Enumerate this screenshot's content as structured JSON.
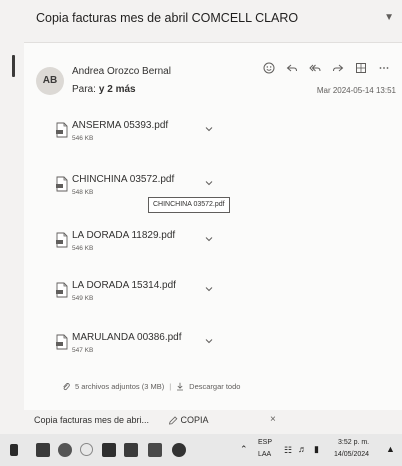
{
  "subject": "Copia facturas mes de abril COMCELL CLARO",
  "sender": {
    "initials": "AB",
    "name": "Andrea Orozco Bernal",
    "to_prefix": "Para:",
    "to_count": "y 2 más"
  },
  "date": "Mar 2024-05-14 13:51",
  "attachments": [
    {
      "name": "ANSERMA 05393.pdf",
      "size": "546 KB"
    },
    {
      "name": "CHINCHINA 03572.pdf",
      "size": "548 KB"
    },
    {
      "name": "LA DORADA 11829.pdf",
      "size": "546 KB"
    },
    {
      "name": "LA DORADA 15314.pdf",
      "size": "549 KB"
    },
    {
      "name": "MARULANDA 00386.pdf",
      "size": "547 KB"
    }
  ],
  "tooltip": "CHINCHINA 03572.pdf",
  "summary": {
    "count_text": "5 archivos adjuntos (3 MB)",
    "download_all": "Descargar todo"
  },
  "bottom_tabs": {
    "draft_tab": "Copia facturas mes de abri...",
    "copy_tab": "COPIA",
    "close": "×"
  },
  "tray": {
    "lang": "ESP",
    "layout": "LAA",
    "time": "3:52 p. m.",
    "date": "14/05/2024"
  },
  "icons": {
    "emoji": "smiley-icon",
    "reply": "reply-icon",
    "reply_all": "reply-all-icon",
    "forward": "forward-icon",
    "apps": "grid-icon",
    "more": "more-icon"
  }
}
